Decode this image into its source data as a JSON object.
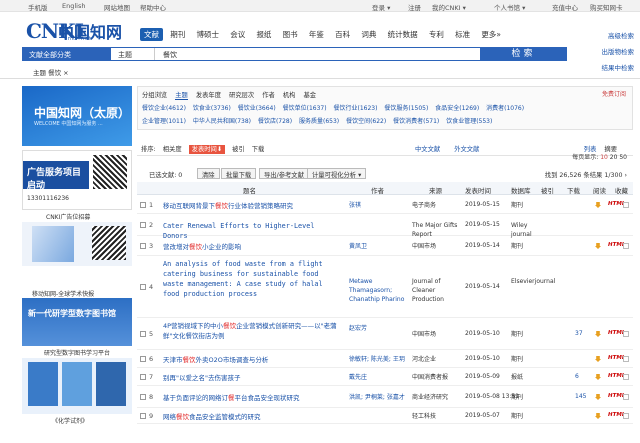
{
  "topbar": {
    "left": [
      "手机版",
      "English",
      "网站地图",
      "帮助中心"
    ],
    "right": [
      "登录 ▾",
      "注册",
      "我的CNKI ▾",
      "个人书馆 ▾",
      "充值中心",
      "购买知网卡"
    ]
  },
  "logo": {
    "cn": "CNKI",
    "zh": "中国知网",
    "sub": "cnki.net"
  },
  "nav": {
    "tabs": [
      "文献",
      "期刊",
      "博硕士",
      "会议",
      "报纸",
      "图书",
      "年鉴",
      "百科",
      "词典",
      "统计数据",
      "专利",
      "标准",
      "更多"
    ],
    "active": "文献",
    "more_suffix": "»"
  },
  "search": {
    "category": "文献全部分类",
    "field": "主题",
    "query": "餐饮",
    "button": "检索"
  },
  "right_links": [
    "高级检索",
    "出版物检索",
    "结果中检索"
  ],
  "breadcrumb": "主题 餐饮 ×",
  "sidebar": {
    "ad1_title": "中国知网（太原）",
    "ad1_sub": "WELCOME 中国知网为服务 ...",
    "ad2_title": "广告服务项目启动",
    "ad2_phone": "13301116236",
    "ad3_caption": "CNKI广告位招募",
    "ad5_caption": "移动知网-全球学术快报",
    "ad6_title": "新一代研学型数字图书馆",
    "ad7_caption": "研究型数字图书学习平台",
    "ad9_caption": "《化学试剂》"
  },
  "groups": {
    "tabs": [
      "分组浏览",
      "主题",
      "发表年度",
      "研究层次",
      "作者",
      "机构",
      "基金"
    ],
    "active": "主题",
    "more": "免费订阅",
    "row1": [
      "餐饮企业(4612)",
      "饮食业(3736)",
      "餐饮业(3664)",
      "餐饮单位(1637)",
      "餐饮行业(1623)",
      "餐饮服务(1505)",
      "食品安全(1269)",
      "消费者(1076)"
    ],
    "row2": [
      "企业管理(1011)",
      "中华人民共和国(738)",
      "餐饮店(728)",
      "服务质量(653)",
      "餐饮空间(622)",
      "餐饮消费者(571)",
      "饮食业管理(553)"
    ]
  },
  "sort": {
    "label": "排序:",
    "items": [
      "相关度",
      "发表时间⬇",
      "被引",
      "下载"
    ],
    "active": "发表时间⬇",
    "languages": [
      "中文文献",
      "外文文献"
    ],
    "view_list": "列表",
    "view_abstract": "摘要"
  },
  "pager": {
    "label": "每页显示:",
    "options": [
      "10",
      "20",
      "50"
    ],
    "active": "10"
  },
  "toolbar": {
    "selected": "已选文献: 0",
    "buttons": [
      "清除",
      "批量下载",
      "导出/参考文献",
      "计量可视化分析 ▾"
    ],
    "found": "找到 26,526 条结果 1/300 ›"
  },
  "columns": [
    "题名",
    "作者",
    "来源",
    "发表时间",
    "数据库",
    "被引",
    "下载",
    "阅读",
    "收藏"
  ],
  "rows": [
    {
      "no": "1",
      "title_pre": "移动互联网背景下",
      "title_hl": "餐饮",
      "title_post": "行业体验营销策略研究",
      "author": "张祺",
      "source": "电子商务",
      "date": "2019-05-15",
      "db": "期刊",
      "cited": "",
      "downloads": "",
      "reading": "HTML"
    },
    {
      "no": "2",
      "title_pre": "Cater Renewal Efforts to Higher-Level Donors",
      "title_hl": "",
      "title_post": "",
      "author": "",
      "source": "The Major Gifts Report",
      "date": "2019-05-15",
      "db": "Wiley journal",
      "cited": "",
      "downloads": "",
      "reading": ""
    },
    {
      "no": "3",
      "title_pre": "营改增对",
      "title_hl": "餐饮",
      "title_post": "小企业的影响",
      "author": "黄凤卫",
      "source": "中国市场",
      "date": "2019-05-14",
      "db": "期刊",
      "cited": "",
      "downloads": "",
      "reading": "HTML"
    },
    {
      "no": "4",
      "title_pre": "An analysis of food waste from a flight catering business for sustainable food waste management: A case study of halal food production process",
      "title_hl": "",
      "title_post": "",
      "author": "Metawe Thamagasorn; Chanathip Pharino",
      "source": "Journal of Cleaner Production",
      "date": "2019-05-14",
      "db": "Elsevierjournal",
      "cited": "",
      "downloads": "",
      "reading": ""
    },
    {
      "no": "5",
      "title_pre": "4P营销视域下的中小",
      "title_hl": "餐饮",
      "title_post": "企业营销模式创新研究——以\"老蒲鲜\"文化餐饮街店为例",
      "author": "赵宏芳",
      "source": "中国市场",
      "date": "2019-05-10",
      "db": "期刊",
      "cited": "",
      "downloads": "37",
      "reading": "HTML"
    },
    {
      "no": "6",
      "title_pre": "天津市",
      "title_hl": "餐饮",
      "title_post": "外卖O2O市场调查与分析",
      "author": "徐敏轩; 陈光美; 王玥",
      "source": "河北企业",
      "date": "2019-05-10",
      "db": "期刊",
      "cited": "",
      "downloads": "",
      "reading": "HTML"
    },
    {
      "no": "7",
      "title_pre": "别再\"以爱之名\"去伤害孩子",
      "title_hl": "",
      "title_post": "",
      "author": "戴先庄",
      "source": "中国消费者报",
      "date": "2019-05-09",
      "db": "报纸",
      "cited": "",
      "downloads": "6",
      "reading": "HTML"
    },
    {
      "no": "8",
      "title_pre": "基于负面评论的网络订",
      "title_hl": "餐",
      "title_post": "平台食品安全现状研究",
      "author": "洪凯; 尹桐莱; 张嘉才",
      "source": "商业经济研究",
      "date": "2019-05-08 13:51",
      "db": "期刊",
      "cited": "",
      "downloads": "145",
      "reading": "HTML"
    },
    {
      "no": "9",
      "title_pre": "网络",
      "title_hl": "餐饮",
      "title_post": "食品安全监管模式的研究",
      "author": "",
      "source": "轻工科技",
      "date": "2019-05-07",
      "db": "期刊",
      "cited": "",
      "downloads": "",
      "reading": "HTML"
    }
  ],
  "colors": {
    "accent": "#1c5fb1",
    "link": "#1a52a8",
    "highlight": "#e02020",
    "sort_active": "#e8543f"
  }
}
